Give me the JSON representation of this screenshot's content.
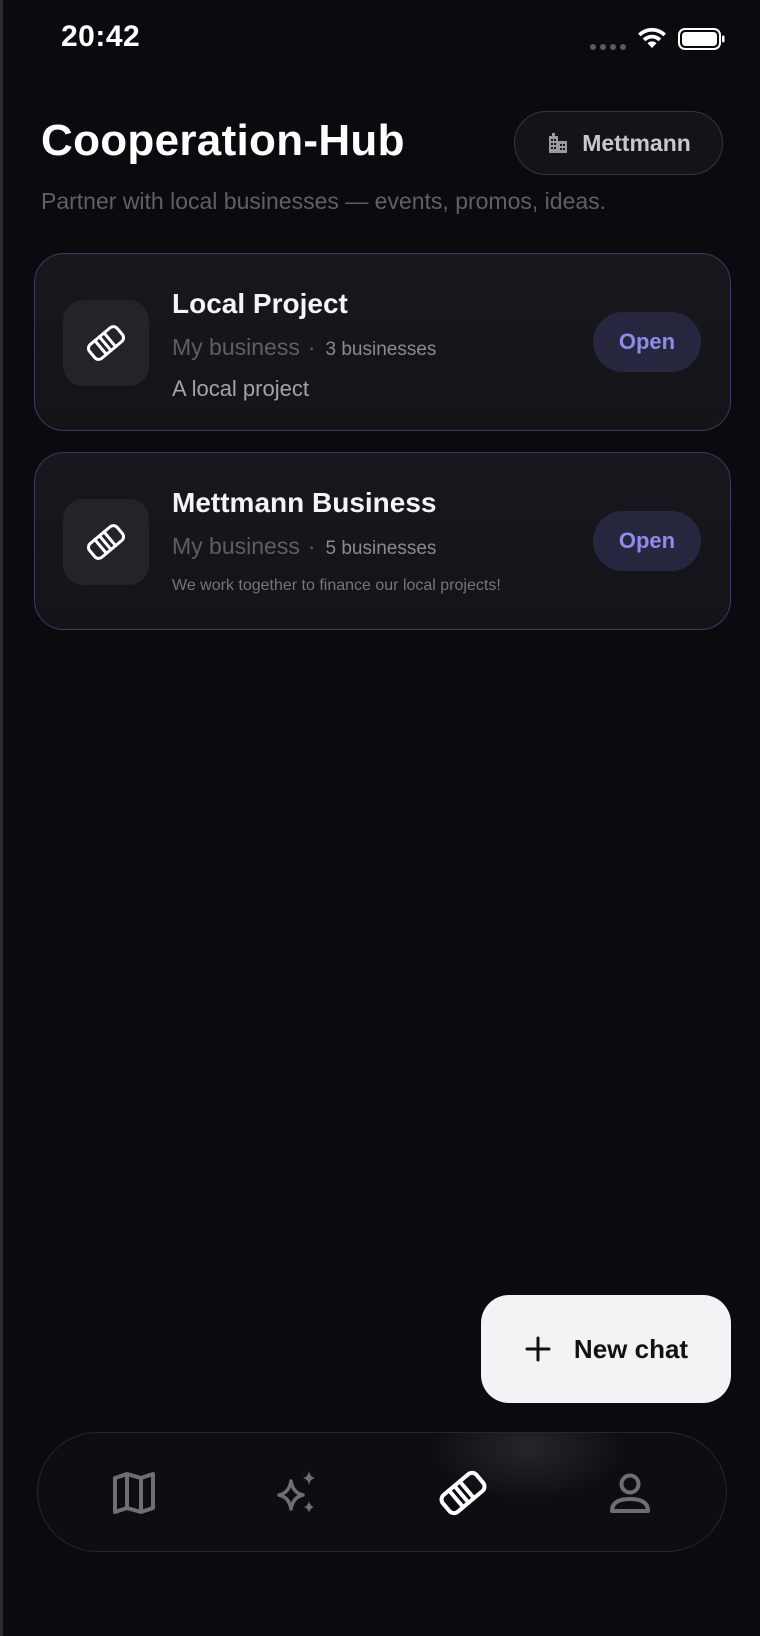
{
  "status_bar": {
    "time": "20:42"
  },
  "header": {
    "title": "Cooperation-Hub",
    "location_chip": {
      "label": "Mettmann",
      "icon": "building-icon"
    },
    "subtitle": "Partner with local businesses — events, promos, ideas."
  },
  "cards": [
    {
      "title": "Local Project",
      "owner": "My business",
      "separator": "·",
      "count": "3 businesses",
      "description": "A local project",
      "icon": "handshake-icon",
      "action_label": "Open"
    },
    {
      "title": "Mettmann Business",
      "owner": "My business",
      "separator": "·",
      "count": "5 businesses",
      "description": "We work together to finance our local projects!",
      "icon": "handshake-icon",
      "action_label": "Open"
    }
  ],
  "fab": {
    "label": "New chat",
    "icon": "plus-icon"
  },
  "bottom_nav": {
    "items": [
      {
        "icon": "map-icon",
        "active": false
      },
      {
        "icon": "sparkles-icon",
        "active": false
      },
      {
        "icon": "handshake-icon",
        "active": true
      },
      {
        "icon": "profile-icon",
        "active": false
      }
    ]
  },
  "colors": {
    "background": "#0b0b0f",
    "card_border": "#3a3a66",
    "accent": "#8f8ce8",
    "button_bg": "#26263f",
    "fab_bg": "#f3f3f5"
  }
}
